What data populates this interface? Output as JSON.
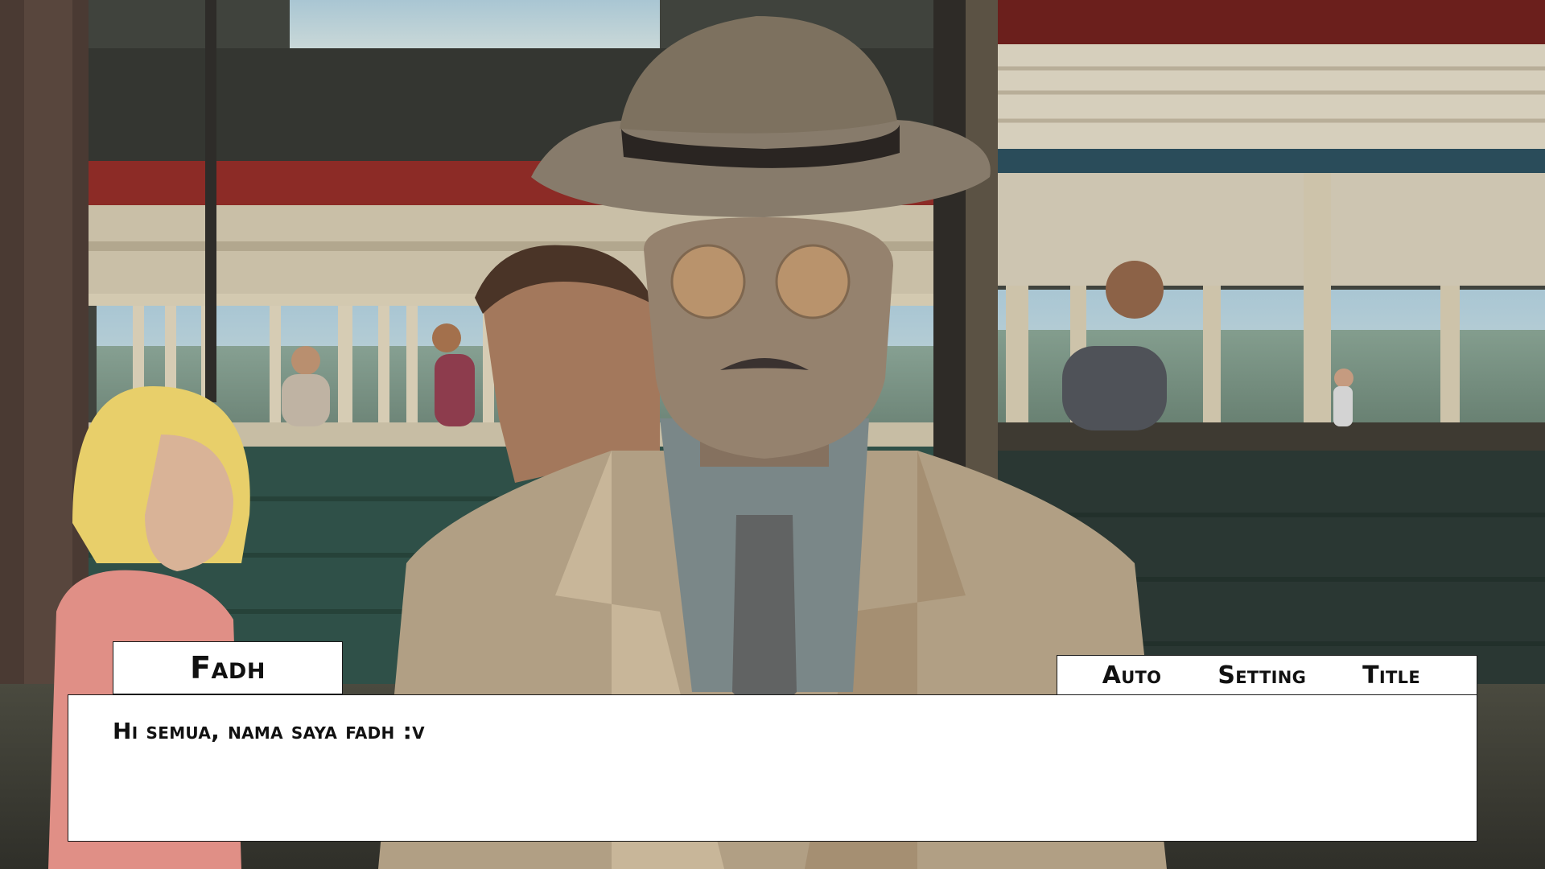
{
  "speaker": {
    "name": "Fadh"
  },
  "dialogue": {
    "text": "Hi semua, nama saya fadh :v"
  },
  "menu": {
    "items": [
      {
        "label": "Auto",
        "icon": ""
      },
      {
        "label": "Setting",
        "icon": ""
      },
      {
        "label": "Title",
        "icon": ""
      }
    ]
  },
  "colors": {
    "panel_bg": "#ffffff",
    "panel_border": "#1a1a1a",
    "text": "#111111",
    "coat": "#b19f84",
    "hat": "#877b6b",
    "train_red": "#8c2b26",
    "train_green": "#2f5048"
  }
}
